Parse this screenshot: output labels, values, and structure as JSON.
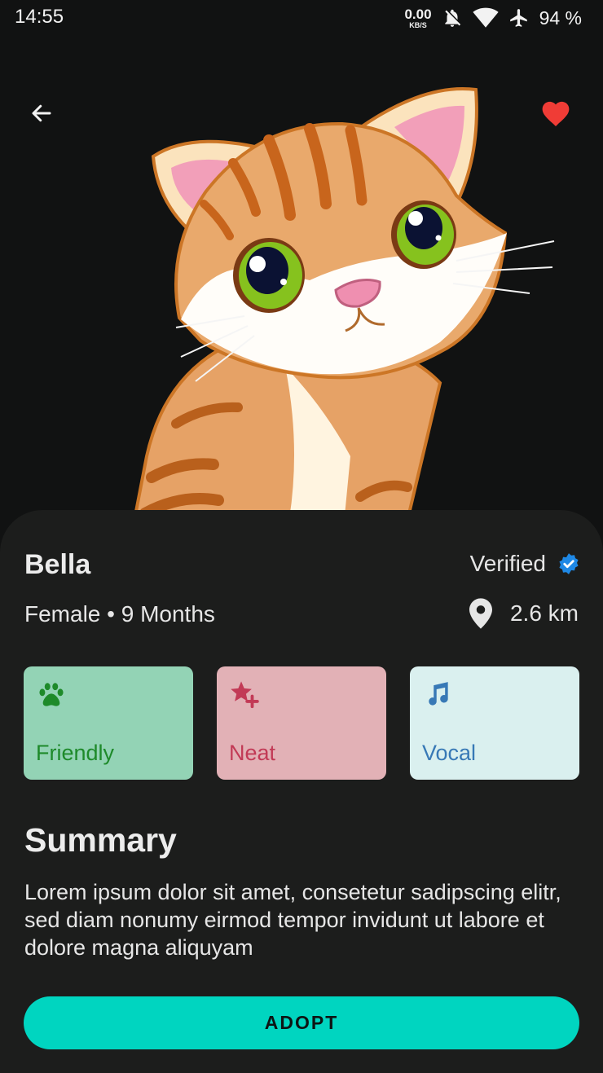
{
  "status_bar": {
    "time": "14:55",
    "net_speed_value": "0.00",
    "net_speed_unit": "KB/S",
    "battery": "94 %",
    "icons": [
      "bell-off-icon",
      "wifi-icon",
      "airplane-icon"
    ]
  },
  "hero": {
    "image": "cartoon-tabby-kitten",
    "favorite": true,
    "favorite_color": "#f03c36"
  },
  "pet": {
    "name": "Bella",
    "info": "Female • 9 Months",
    "verified_label": "Verified",
    "verified_color": "#1e88e5",
    "distance": "2.6 km"
  },
  "traits": [
    {
      "label": "Friendly",
      "icon": "paw-icon",
      "bg": "#93d3b5",
      "fg": "#1e8a2a"
    },
    {
      "label": "Neat",
      "icon": "star-plus-icon",
      "bg": "#e2b1b6",
      "fg": "#c23a56"
    },
    {
      "label": "Vocal",
      "icon": "music-note-icon",
      "bg": "#daf0ef",
      "fg": "#3879b6"
    }
  ],
  "summary": {
    "title": "Summary",
    "text": "Lorem ipsum dolor sit amet, consetetur sadipscing elitr, sed diam nonumy eirmod tempor invidunt ut labore et dolore magna aliquyam"
  },
  "actions": {
    "adopt_label": "ADOPT",
    "adopt_color": "#00d5c0"
  }
}
